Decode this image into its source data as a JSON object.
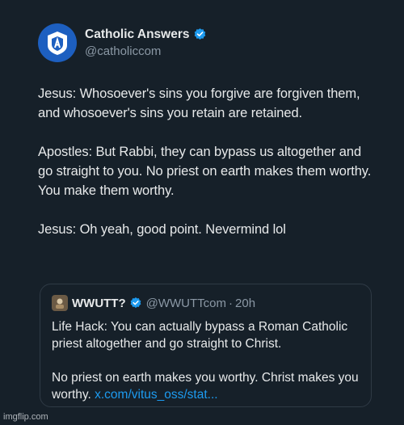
{
  "tweet": {
    "author": {
      "display_name": "Catholic Answers",
      "handle": "@catholiccom",
      "verified": true,
      "avatar_icon": "catholic-answers-logo"
    },
    "paragraphs": [
      "Jesus: Whosoever's sins you forgive are forgiven them, and whosoever's sins you retain are retained.",
      "Apostles: But Rabbi, they can bypass us altogether and go straight to you. No priest on earth makes them worthy. You make them worthy.",
      "Jesus: Oh yeah, good point. Nevermind lol"
    ]
  },
  "quoted_tweet": {
    "author": {
      "display_name": "WWUTT?",
      "handle": "@WWUTTcom",
      "time": "20h",
      "separator": "·",
      "verified": true
    },
    "paragraph_1": "Life Hack: You can actually bypass a Roman Catholic priest altogether and go straight to Christ.",
    "paragraph_2_text": "No priest on earth makes you worthy. Christ makes you worthy. ",
    "paragraph_2_link": "x.com/vitus_oss/stat..."
  },
  "watermark": "imgflip.com",
  "colors": {
    "background": "#162029",
    "text": "#e7e9ea",
    "secondary_text": "#8b98a5",
    "link": "#1d9bf0",
    "verified_badge": "#1d9bf0"
  }
}
